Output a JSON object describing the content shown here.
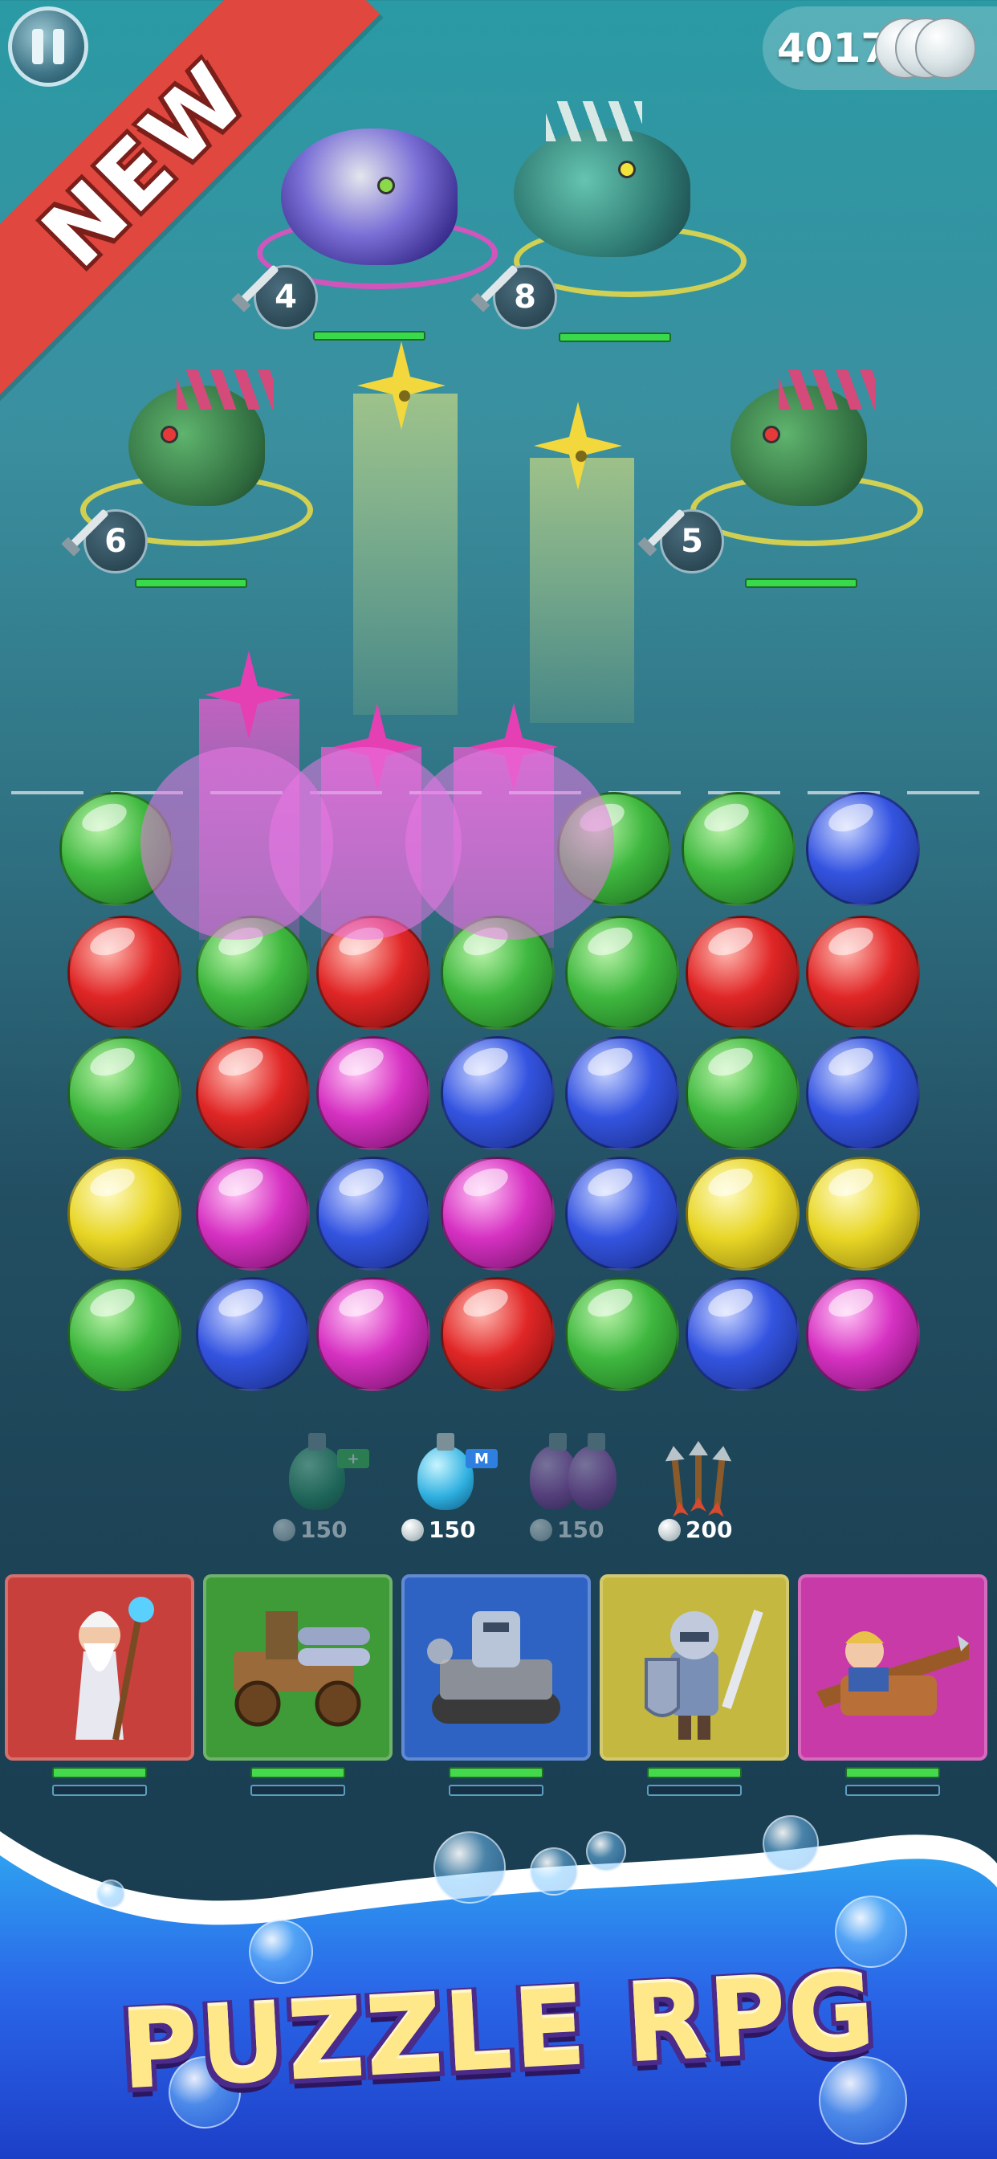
{
  "top_bar": {
    "pause_icon": "pause-icon",
    "ribbon_label": "NEW",
    "currency_value": "4017",
    "currency_icon": "pearl-icon"
  },
  "enemies": [
    {
      "id": "crab",
      "attack": "4",
      "icon": "crab-monster-icon"
    },
    {
      "id": "fish",
      "attack": "8",
      "icon": "fish-monster-icon"
    },
    {
      "id": "lizard-left",
      "attack": "6",
      "icon": "lizard-monster-icon"
    },
    {
      "id": "lizard-right",
      "attack": "5",
      "icon": "lizard-monster-icon"
    }
  ],
  "board": {
    "colors": {
      "green": "#3fb83f",
      "red": "#e02626",
      "blue": "#3454e0",
      "magenta": "#d631c2",
      "yellow": "#e8d626"
    },
    "rows": [
      [
        "green",
        "",
        "",
        "",
        "green",
        "green",
        "blue"
      ],
      [
        "red",
        "green",
        "red",
        "green",
        "green",
        "red",
        "red"
      ],
      [
        "green",
        "red",
        "magenta",
        "blue",
        "blue",
        "green",
        "blue"
      ],
      [
        "yellow",
        "magenta",
        "blue",
        "magenta",
        "blue",
        "yellow",
        "yellow"
      ],
      [
        "green",
        "blue",
        "magenta",
        "red",
        "green",
        "blue",
        "magenta"
      ]
    ]
  },
  "items": [
    {
      "name": "green-potion",
      "cost": "150",
      "tag": "+",
      "available": false
    },
    {
      "name": "blue-potion",
      "cost": "150",
      "tag": "M",
      "available": true
    },
    {
      "name": "purple-potions",
      "cost": "150",
      "tag": "",
      "available": false
    },
    {
      "name": "arrows",
      "cost": "200",
      "tag": "",
      "available": true
    }
  ],
  "heroes": [
    {
      "name": "wizard",
      "color": "#c8403c",
      "icon": "wizard-icon"
    },
    {
      "name": "catapult",
      "color": "#3f9a38",
      "icon": "catapult-icon"
    },
    {
      "name": "tank",
      "color": "#2e63c4",
      "icon": "tank-icon"
    },
    {
      "name": "knight",
      "color": "#c4b840",
      "icon": "knight-icon"
    },
    {
      "name": "ballista",
      "color": "#c93aa9",
      "icon": "ballista-icon"
    }
  ],
  "banner": {
    "title": "PUZZLE RPG"
  }
}
